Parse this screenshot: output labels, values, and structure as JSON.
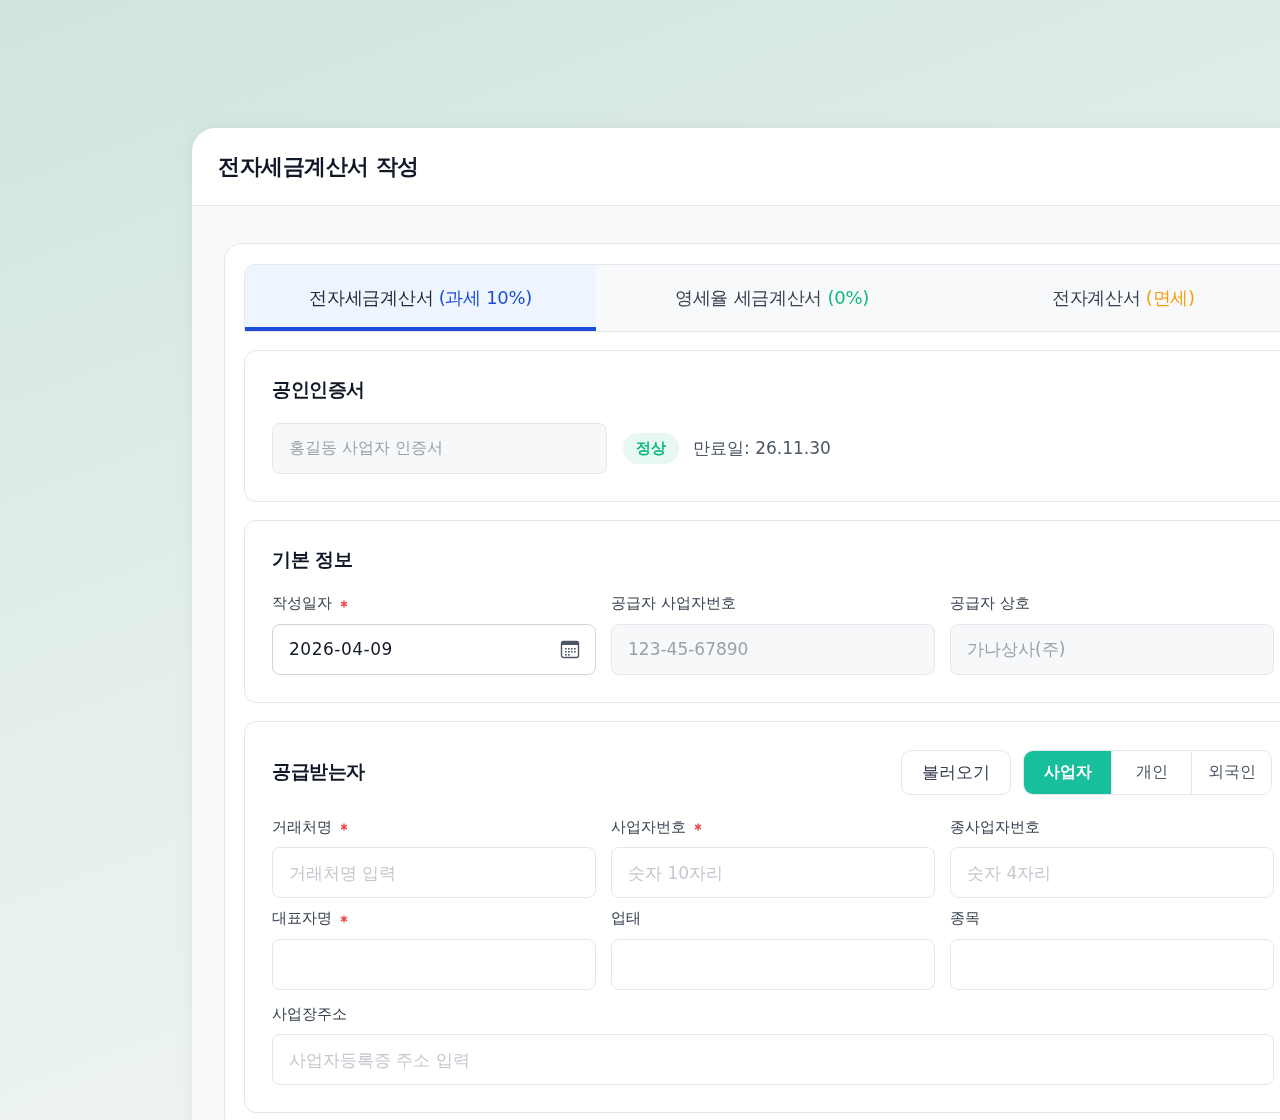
{
  "window": {
    "title": "전자세금계산서 작성"
  },
  "tabs": [
    {
      "label": "전자세금계산서",
      "note": "(과세 10%)",
      "color": "#1d4ed8",
      "selected": true
    },
    {
      "label": "영세율 세금계산서",
      "note": "(0%)",
      "color": "#10b981",
      "selected": false
    },
    {
      "label": "전자계산서",
      "note": "(면세)",
      "color": "#f59e0b",
      "selected": false
    }
  ],
  "certificate": {
    "title": "공인인증서",
    "field": {
      "value": "홍길동 사업자 인증서",
      "disabled": true
    },
    "status": "정상",
    "expiry": "만료일: 26.11.30"
  },
  "basic_info": {
    "title": "기본 정보",
    "fields": [
      {
        "label": "작성일자",
        "required": true,
        "value": "2026-04-09",
        "disabled": false,
        "kind": "date"
      },
      {
        "label": "공급자 사업자번호",
        "required": false,
        "value": "123-45-67890",
        "disabled": true,
        "kind": "text"
      },
      {
        "label": "공급자 상호",
        "required": false,
        "value": "가나상사(주)",
        "disabled": true,
        "kind": "text"
      }
    ]
  },
  "recipient": {
    "title": "공급받는자",
    "load_button": "불러오기",
    "types": [
      {
        "label": "사업자",
        "selected": true
      },
      {
        "label": "개인",
        "selected": false
      },
      {
        "label": "외국인",
        "selected": false
      }
    ],
    "fields": [
      {
        "label": "거래처명",
        "required": true,
        "placeholder": "거래처명 입력"
      },
      {
        "label": "사업자번호",
        "required": true,
        "placeholder": "숫자 10자리"
      },
      {
        "label": "종사업자번호",
        "required": false,
        "placeholder": "숫자 4자리"
      },
      {
        "label": "대표자명",
        "required": true
      },
      {
        "label": "업태",
        "required": false
      },
      {
        "label": "종목",
        "required": false
      }
    ],
    "address": {
      "label": "사업장주소",
      "required": false,
      "placeholder": "사업자등록증 주소 입력"
    }
  }
}
